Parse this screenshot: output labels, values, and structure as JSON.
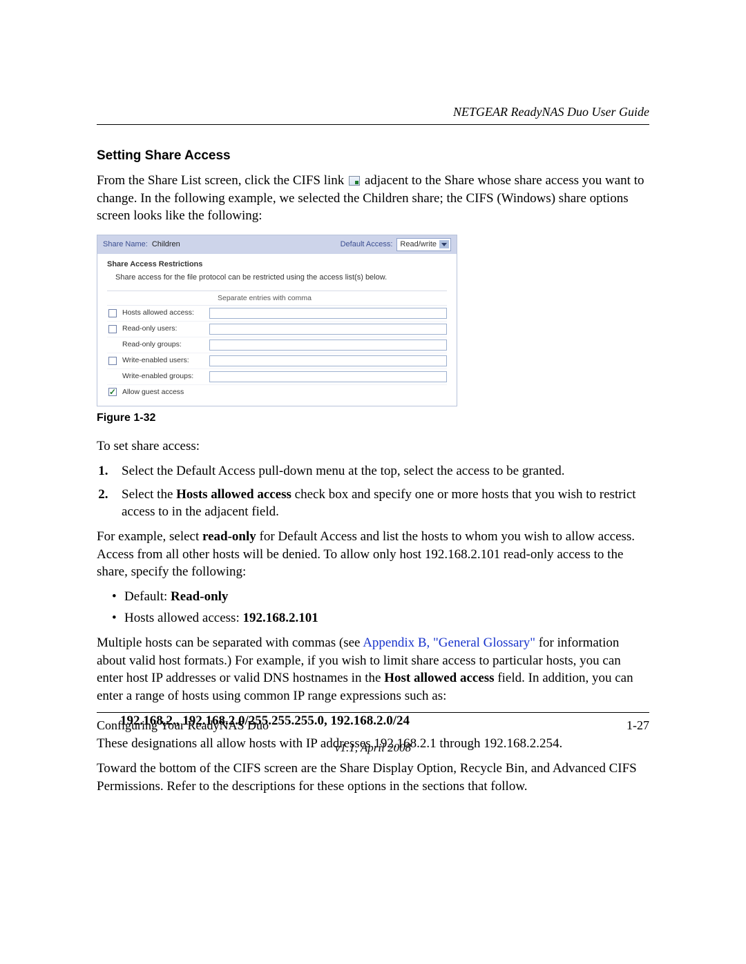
{
  "doc_title": "NETGEAR ReadyNAS Duo User Guide",
  "section_heading": "Setting Share Access",
  "intro": {
    "pre_icon": "From the Share List screen, click the CIFS link ",
    "post_icon": " adjacent to the Share whose share access you want to change. In the following example, we selected the Children share; the CIFS (Windows) share options screen looks like the following:"
  },
  "figure": {
    "share_name_label": "Share Name:",
    "share_name_value": "Children",
    "default_access_label": "Default Access:",
    "default_access_value": "Read/write",
    "restrictions_heading": "Share Access Restrictions",
    "restrictions_note": "Share access for the file protocol can be restricted using the access list(s) below.",
    "column_hint": "Separate entries with comma",
    "rows": [
      {
        "label": "Hosts allowed access:",
        "checkbox": true,
        "checked": false,
        "input": true
      },
      {
        "label": "Read-only users:",
        "checkbox": true,
        "checked": false,
        "input": true
      },
      {
        "label": "Read-only groups:",
        "checkbox": false,
        "checked": false,
        "input": true
      },
      {
        "label": "Write-enabled users:",
        "checkbox": true,
        "checked": false,
        "input": true
      },
      {
        "label": "Write-enabled groups:",
        "checkbox": false,
        "checked": false,
        "input": true
      },
      {
        "label": "Allow guest access",
        "checkbox": true,
        "checked": true,
        "input": false
      }
    ],
    "caption": "Figure 1-32"
  },
  "lead_in": "To set share access:",
  "steps": {
    "s1": "Select the Default Access pull-down menu at the top, select the access to be granted.",
    "s2_pre": "Select the ",
    "s2_bold": "Hosts allowed access",
    "s2_post": " check box and specify one or more hosts that you wish to restrict access to in the adjacent field."
  },
  "para_example": {
    "pre": "For example, select ",
    "bold": "read-only",
    "post": " for Default Access and list the hosts to whom you wish to allow access. Access from all other hosts will be denied. To allow only host 192.168.2.101 read-only access to the share, specify the following:"
  },
  "bullets": {
    "b1_pre": "Default: ",
    "b1_bold": "Read-only",
    "b2_pre": "Hosts allowed access: ",
    "b2_bold": "192.168.2.101"
  },
  "para_multi": {
    "pre": "Multiple hosts can be separated with commas (see ",
    "link": "Appendix B, \"General Glossary\"",
    "mid": " for information about valid host formats.) For example, if you wish to limit share access to particular hosts, you can enter host IP addresses or valid DNS hostnames in the ",
    "bold": "Host allowed access",
    "post": " field. In addition, you can enter a range of hosts using common IP range expressions such as:"
  },
  "ip_block": "192.168.2., 192.168.2.0/255.255.255.0, 192.168.2.0/24",
  "para_designations": "These designations all allow hosts with IP addresses 192.168.2.1 through 192.168.2.254.",
  "para_bottom": "Toward the bottom of the CIFS screen are the Share Display Option, Recycle Bin, and Advanced CIFS Permissions. Refer to the descriptions for these options in the sections that follow.",
  "footer": {
    "left": "Configuring Your ReadyNAS Duo",
    "right": "1-27",
    "version": "v1.1, April 2008"
  }
}
